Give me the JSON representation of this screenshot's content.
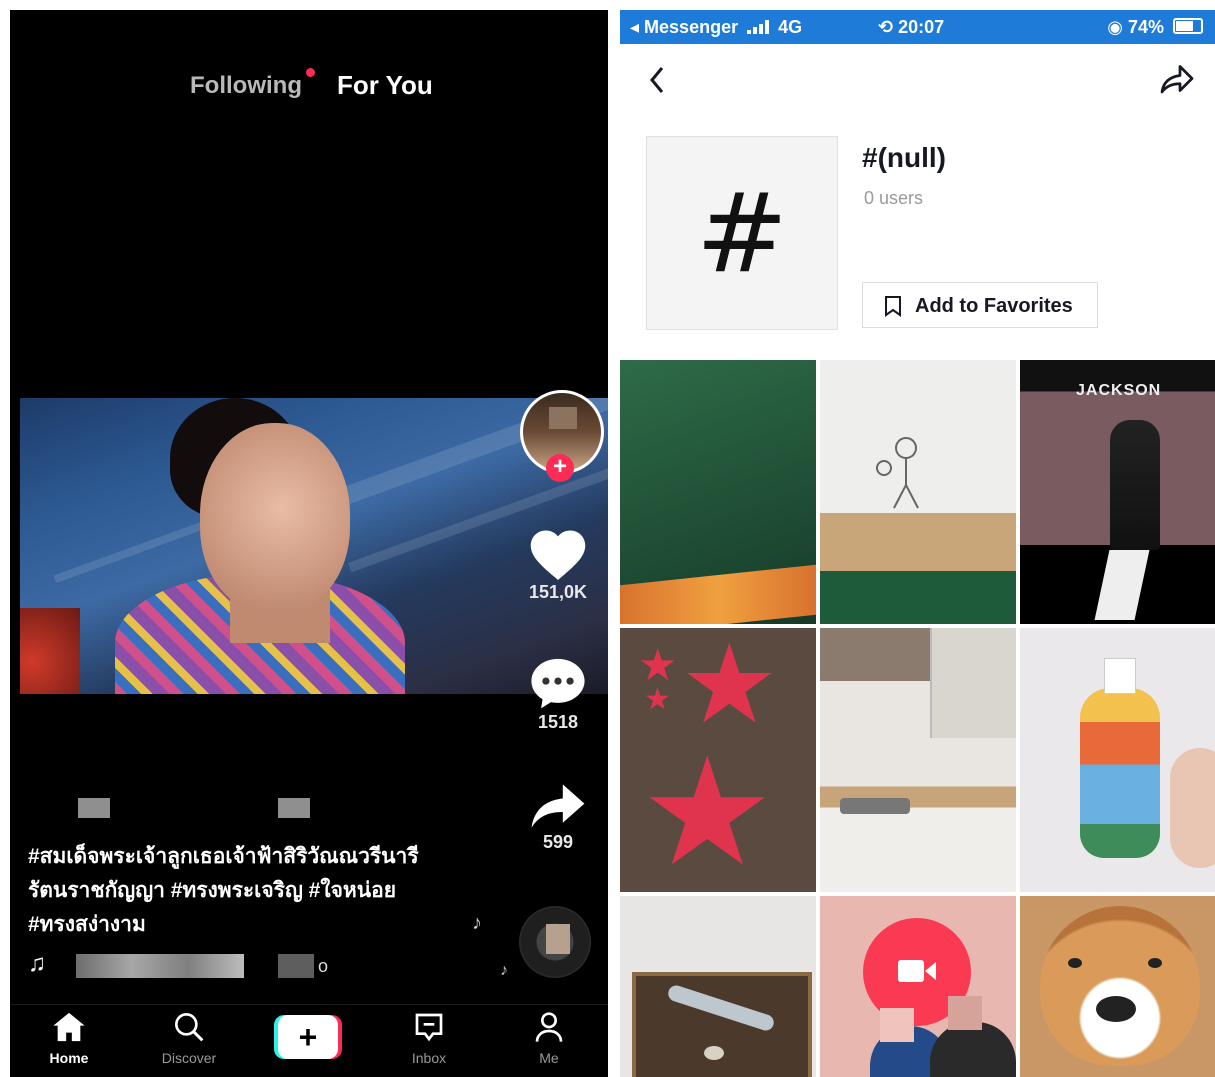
{
  "left": {
    "tabs": {
      "following": "Following",
      "for_you": "For You"
    },
    "actions": {
      "likes": "151,0K",
      "comments": "1518",
      "shares": "599"
    },
    "caption": {
      "line1": "#สมเด็จพระเจ้าลูกเธอเจ้าฟ้าสิริวัณณวรีนารี",
      "line2": "รัตนราชกัญญา #ทรงพระเจริญ #ใจหน่อย",
      "line3": "#ทรงสง่างาม"
    },
    "music_note": "♫",
    "music_tail": "o",
    "nav": {
      "home": "Home",
      "discover": "Discover",
      "create": "+",
      "inbox": "Inbox",
      "me": "Me"
    }
  },
  "right": {
    "status": {
      "app": "◂ Messenger",
      "network": "4G",
      "time": "20:07",
      "battery": "74%"
    },
    "hashtag": {
      "glyph": "#",
      "title": "#(null)",
      "users": "0  users"
    },
    "favorites_label": "Add to Favorites",
    "grid_texts": {
      "jackson": "JACKSON"
    }
  },
  "colors": {
    "accent": "#fe2c55",
    "cyan": "#25f4ee",
    "status_bar": "#1e7bd8"
  }
}
